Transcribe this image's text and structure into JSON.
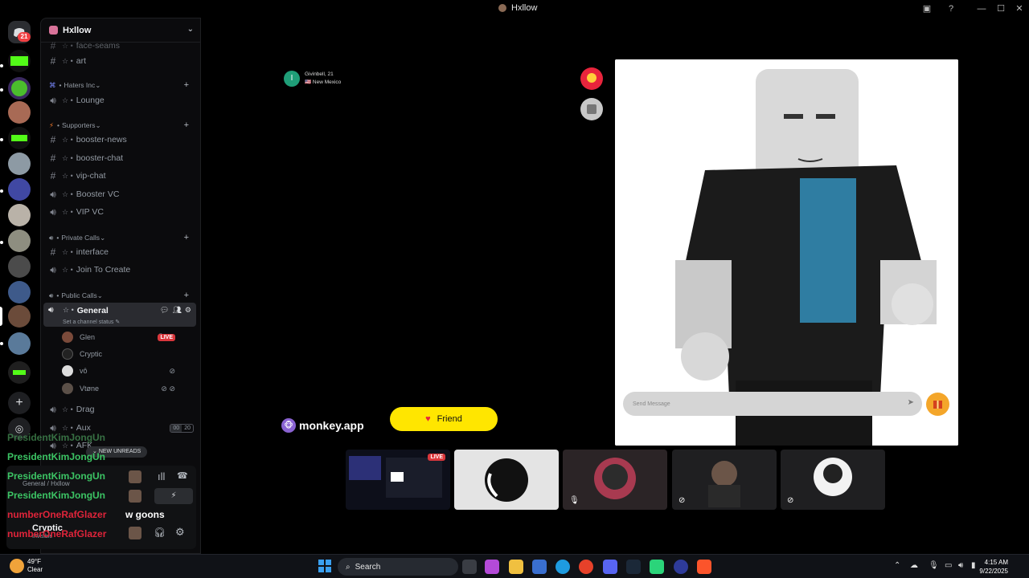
{
  "window": {
    "title": "Hxllow"
  },
  "rail": {
    "badge_count": "21"
  },
  "server": {
    "name": "Hxllow"
  },
  "channels": [
    {
      "id": "face-seams",
      "label": "face-seams",
      "type": "text"
    },
    {
      "id": "art",
      "label": "art",
      "type": "text"
    },
    {
      "id": "lounge",
      "label": "Lounge",
      "type": "voice"
    },
    {
      "id": "booster-news",
      "label": "booster-news",
      "type": "text"
    },
    {
      "id": "booster-chat",
      "label": "booster-chat",
      "type": "text"
    },
    {
      "id": "vip-chat",
      "label": "vip-chat",
      "type": "text"
    },
    {
      "id": "booster-vc",
      "label": "Booster VC",
      "type": "voice"
    },
    {
      "id": "vip-vc",
      "label": "VIP VC",
      "type": "voice"
    },
    {
      "id": "interface",
      "label": "interface",
      "type": "text"
    },
    {
      "id": "join-to-create",
      "label": "Join To Create",
      "type": "voice"
    },
    {
      "id": "general",
      "label": "General",
      "type": "voice"
    },
    {
      "id": "drag",
      "label": "Drag",
      "type": "voice"
    },
    {
      "id": "aux",
      "label": "Aux",
      "type": "voice"
    },
    {
      "id": "afk",
      "label": "AFK",
      "type": "voice"
    }
  ],
  "categories": {
    "haters": "Haters Inc",
    "supporters": "Supporters",
    "private": "Private Calls",
    "public": "Public Calls"
  },
  "general_status": "Set a channel status",
  "voice_users": [
    {
      "name": "Glen",
      "live": "LIVE"
    },
    {
      "name": "Cryptic"
    },
    {
      "name": "vô"
    },
    {
      "name": "Vtøne"
    }
  ],
  "aux_counts": {
    "current": "00",
    "limit": "20"
  },
  "new_unreads": "NEW UNREADS",
  "chat_overlay": [
    {
      "text": "PresidentKimJongUn",
      "color": "#4a9b5a"
    },
    {
      "text": "PresidentKimJongUn",
      "color": "#3cc464"
    },
    {
      "text": "PresidentKimJongUn",
      "color": "#3cc464"
    },
    {
      "text": "PresidentKimJongUn",
      "color": "#3cc464"
    },
    {
      "text": "numberOneRafGlazer",
      "color": "#e0243a"
    },
    {
      "text": "numberOneRafGlazer",
      "color": "#e0243a"
    }
  ],
  "chat_overlay_msg": "w goons",
  "voice_connected": {
    "channel": "General / Hxllow"
  },
  "user": {
    "name": "Cryptic",
    "status": "Invisible"
  },
  "peer": {
    "initial": "I",
    "line1": "Givinbell, 21",
    "line2": "🇺🇸 New Mexico"
  },
  "message_placeholder": "Send Message",
  "friend_label": "Friend",
  "brand": "monkey.app",
  "tiles": {
    "live": "LIVE"
  },
  "taskbar": {
    "weather_temp": "49°F",
    "weather_desc": "Clear",
    "search": "Search",
    "time": "4:15 AM",
    "date": "9/22/2025"
  },
  "colors": {
    "accent_yellow": "#ffe600",
    "live_red": "#da373c",
    "gift": "#f4a62a"
  }
}
